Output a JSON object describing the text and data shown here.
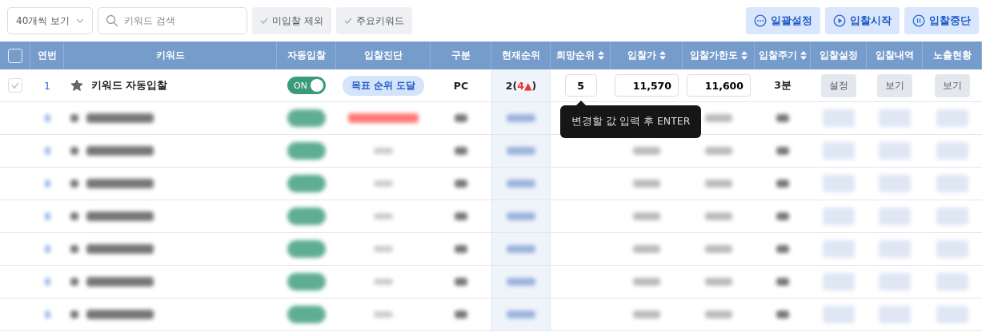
{
  "toolbar": {
    "page_size": "40개씩 보기",
    "search": {
      "placeholder": "키워드 검색"
    },
    "filters": [
      {
        "label": "미입찰 제외",
        "checked": false
      },
      {
        "label": "주요키워드",
        "checked": false
      }
    ],
    "actions": [
      {
        "label": "일괄설정",
        "kind": "more"
      },
      {
        "label": "입찰시작",
        "kind": "play"
      },
      {
        "label": "입찰중단",
        "kind": "pause"
      }
    ]
  },
  "table": {
    "all_checked": false,
    "columns": [
      {
        "label": "연번",
        "sortable": false
      },
      {
        "label": "키워드",
        "sortable": false
      },
      {
        "label": "자동입찰",
        "sortable": false
      },
      {
        "label": "입찰진단",
        "sortable": false
      },
      {
        "label": "구분",
        "sortable": false
      },
      {
        "label": "현재순위",
        "sortable": false
      },
      {
        "label": "희망순위",
        "sortable": true
      },
      {
        "label": "입찰가",
        "sortable": true
      },
      {
        "label": "입찰가한도",
        "sortable": true
      },
      {
        "label": "입찰주기",
        "sortable": true
      },
      {
        "label": "입찰설정",
        "sortable": false
      },
      {
        "label": "입찰내역",
        "sortable": false
      },
      {
        "label": "노출현황",
        "sortable": false
      }
    ],
    "row": {
      "checked": false,
      "no": "1",
      "starred": true,
      "keyword": "키워드 자동입찰",
      "auto_bid": {
        "on": true,
        "label": "ON"
      },
      "diagnosis": "목표 순위 도달",
      "device": "PC",
      "rank": "2(",
      "rank_change": "4▲",
      "rank_close": ")",
      "target_rank": "5",
      "bid": "11,570",
      "bid_limit": "11,600",
      "cycle": "3분",
      "setting_button": "설정",
      "history_button": "보기",
      "exposure_button": "보기"
    },
    "tooltip": "변경할 값 입력 후 ENTER",
    "blurred_rows": [
      {
        "on": true,
        "alert": true
      },
      {
        "on": true,
        "alert": false
      },
      {
        "on": true,
        "alert": false
      },
      {
        "on": true,
        "alert": false
      },
      {
        "on": true,
        "alert": false
      },
      {
        "on": true,
        "alert": false
      },
      {
        "on": true,
        "alert": false
      }
    ]
  }
}
